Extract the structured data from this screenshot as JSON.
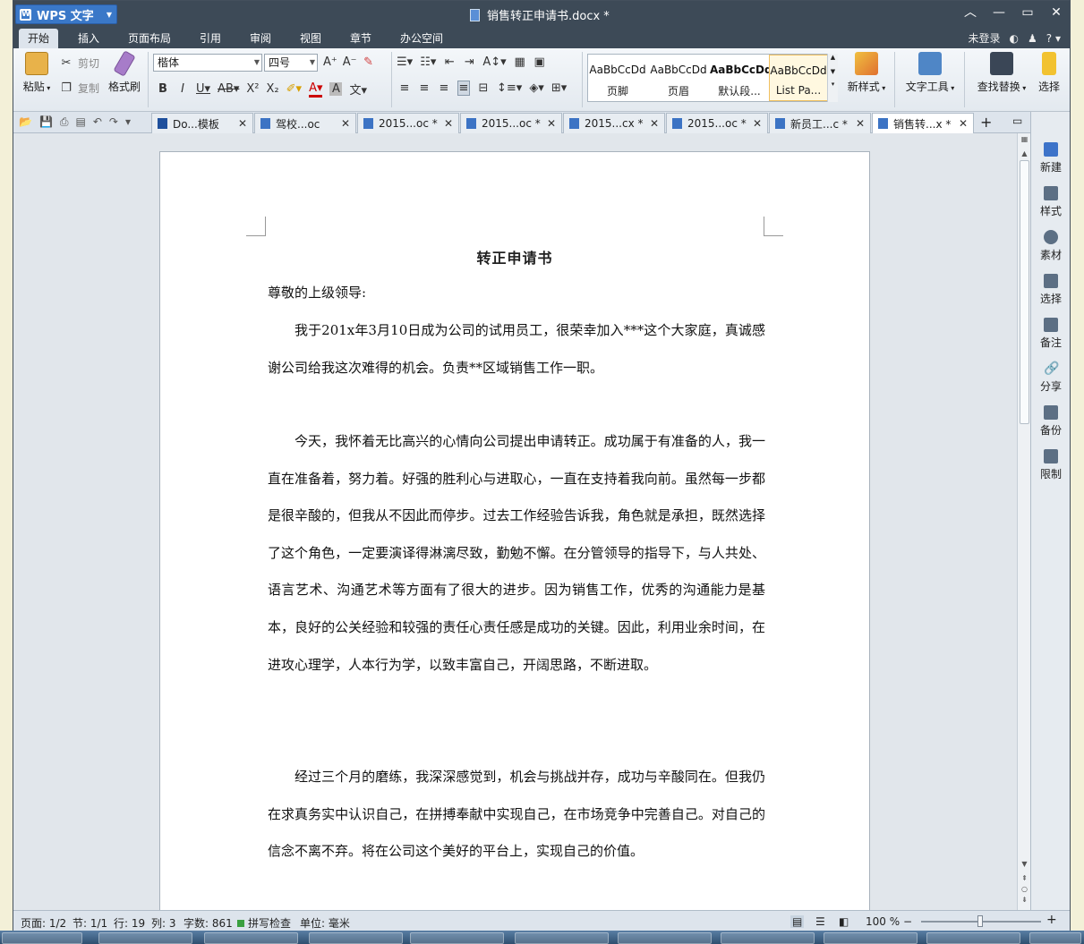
{
  "window": {
    "app_name": "WPS 文字",
    "doc_title": "销售转正申请书.docx *"
  },
  "menu": {
    "tabs": [
      "开始",
      "插入",
      "页面布局",
      "引用",
      "审阅",
      "视图",
      "章节",
      "办公空间"
    ],
    "active_tab": "开始",
    "login": "未登录"
  },
  "ribbon": {
    "paste": "粘贴",
    "cut": "剪切",
    "copy": "复制",
    "format_painter": "格式刷",
    "font_name": "楷体",
    "font_size": "四号",
    "styles": [
      {
        "sample": "AaBbCcDd",
        "name": "页脚"
      },
      {
        "sample": "AaBbCcDd",
        "name": "页眉"
      },
      {
        "sample": "AaBbCcDd",
        "name": "默认段..."
      },
      {
        "sample": "AaBbCcDd",
        "name": "List Pa..."
      }
    ],
    "new_style": "新样式",
    "text_tools": "文字工具",
    "find_replace": "查找替换",
    "select": "选择"
  },
  "doc_tabs": [
    {
      "label": "Do...模板"
    },
    {
      "label": "驾校...oc"
    },
    {
      "label": "2015...oc *"
    },
    {
      "label": "2015...oc *"
    },
    {
      "label": "2015...cx *"
    },
    {
      "label": "2015...oc *"
    },
    {
      "label": "新员工...c *"
    },
    {
      "label": "销售转...x *"
    }
  ],
  "task_pane": [
    "新建",
    "样式",
    "素材",
    "选择",
    "备注",
    "分享",
    "备份",
    "限制"
  ],
  "document": {
    "title": "转正申请书",
    "salutation": "尊敬的上级领导:",
    "paragraphs": [
      "我于201x年3月10日成为公司的试用员工，很荣幸加入***这个大家庭，真诚感谢公司给我这次难得的机会。负责**区域销售工作一职。",
      "今天，我怀着无比高兴的心情向公司提出申请转正。成功属于有准备的人，我一直在准备着，努力着。好强的胜利心与进取心，一直在支持着我向前。虽然每一步都是很辛酸的，但我从不因此而停步。过去工作经验告诉我，角色就是承担，既然选择了这个角色，一定要演译得淋漓尽致，勤勉不懈。在分管领导的指导下，与人共处、语言艺术、沟通艺术等方面有了很大的进步。因为销售工作，优秀的沟通能力是基本，良好的公关经验和较强的责任心责任感是成功的关键。因此，利用业余时间，在进攻心理学，人本行为学，以致丰富自己，开阔思路，不断进取。",
      "经过三个月的磨练，我深深感觉到，机会与挑战并存，成功与辛酸同在。但我仍在求真务实中认识自己，在拼搏奉献中实现自己，在市场竞争中完善自己。对自己的信念不离不弃。将在公司这个美好的平台上，实现自己的价值。"
    ]
  },
  "status": {
    "page": "页面: 1/2",
    "section": "节: 1/1",
    "row": "行: 19",
    "col": "列: 3",
    "word_count": "字数: 861",
    "spell_check": "拼写检查",
    "unit": "单位: 毫米",
    "zoom": "100 %",
    "zoom_fraction": 0.5
  }
}
